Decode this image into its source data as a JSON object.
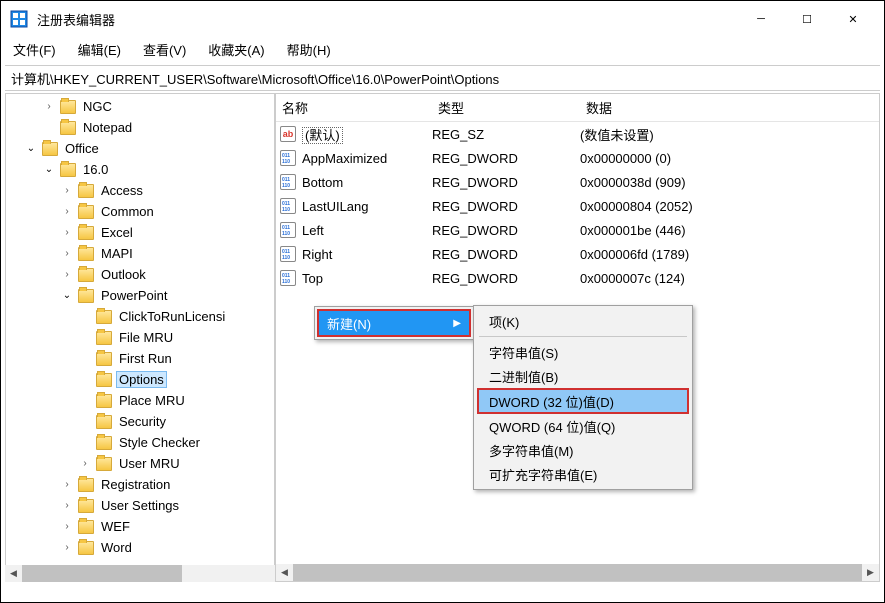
{
  "title": "注册表编辑器",
  "menubar": [
    "文件(F)",
    "编辑(E)",
    "查看(V)",
    "收藏夹(A)",
    "帮助(H)"
  ],
  "address": "计算机\\HKEY_CURRENT_USER\\Software\\Microsoft\\Office\\16.0\\PowerPoint\\Options",
  "tree": {
    "nodes": [
      {
        "indent": 2,
        "exp": ">",
        "label": "NGC"
      },
      {
        "indent": 2,
        "exp": "",
        "label": "Notepad"
      },
      {
        "indent": 1,
        "exp": "v",
        "label": "Office"
      },
      {
        "indent": 2,
        "exp": "v",
        "label": "16.0"
      },
      {
        "indent": 3,
        "exp": ">",
        "label": "Access"
      },
      {
        "indent": 3,
        "exp": ">",
        "label": "Common"
      },
      {
        "indent": 3,
        "exp": ">",
        "label": "Excel"
      },
      {
        "indent": 3,
        "exp": ">",
        "label": "MAPI"
      },
      {
        "indent": 3,
        "exp": ">",
        "label": "Outlook"
      },
      {
        "indent": 3,
        "exp": "v",
        "label": "PowerPoint"
      },
      {
        "indent": 4,
        "exp": "",
        "label": "ClickToRunLicensi"
      },
      {
        "indent": 4,
        "exp": "",
        "label": "File MRU"
      },
      {
        "indent": 4,
        "exp": "",
        "label": "First Run"
      },
      {
        "indent": 4,
        "exp": "",
        "label": "Options",
        "selected": true
      },
      {
        "indent": 4,
        "exp": "",
        "label": "Place MRU"
      },
      {
        "indent": 4,
        "exp": "",
        "label": "Security"
      },
      {
        "indent": 4,
        "exp": "",
        "label": "Style Checker"
      },
      {
        "indent": 4,
        "exp": ">",
        "label": "User MRU"
      },
      {
        "indent": 3,
        "exp": ">",
        "label": "Registration"
      },
      {
        "indent": 3,
        "exp": ">",
        "label": "User Settings"
      },
      {
        "indent": 3,
        "exp": ">",
        "label": "WEF"
      },
      {
        "indent": 3,
        "exp": ">",
        "label": "Word"
      }
    ]
  },
  "columns": {
    "name": "名称",
    "type": "类型",
    "data": "数据"
  },
  "values": [
    {
      "icon": "str",
      "name": "(默认)",
      "type": "REG_SZ",
      "data": "(数值未设置)",
      "default": true
    },
    {
      "icon": "bin",
      "name": "AppMaximized",
      "type": "REG_DWORD",
      "data": "0x00000000 (0)"
    },
    {
      "icon": "bin",
      "name": "Bottom",
      "type": "REG_DWORD",
      "data": "0x0000038d (909)"
    },
    {
      "icon": "bin",
      "name": "LastUILang",
      "type": "REG_DWORD",
      "data": "0x00000804 (2052)"
    },
    {
      "icon": "bin",
      "name": "Left",
      "type": "REG_DWORD",
      "data": "0x000001be (446)"
    },
    {
      "icon": "bin",
      "name": "Right",
      "type": "REG_DWORD",
      "data": "0x000006fd (1789)"
    },
    {
      "icon": "bin",
      "name": "Top",
      "type": "REG_DWORD",
      "data": "0x0000007c (124)"
    }
  ],
  "context": {
    "new": "新建(N)",
    "items": [
      {
        "label": "项(K)"
      },
      {
        "sep": true
      },
      {
        "label": "字符串值(S)"
      },
      {
        "label": "二进制值(B)"
      },
      {
        "label": "DWORD (32 位)值(D)",
        "hl": true
      },
      {
        "label": "QWORD (64 位)值(Q)"
      },
      {
        "label": "多字符串值(M)"
      },
      {
        "label": "可扩充字符串值(E)"
      }
    ]
  },
  "icons": {
    "str": "ab",
    "bin": "011\n110"
  }
}
